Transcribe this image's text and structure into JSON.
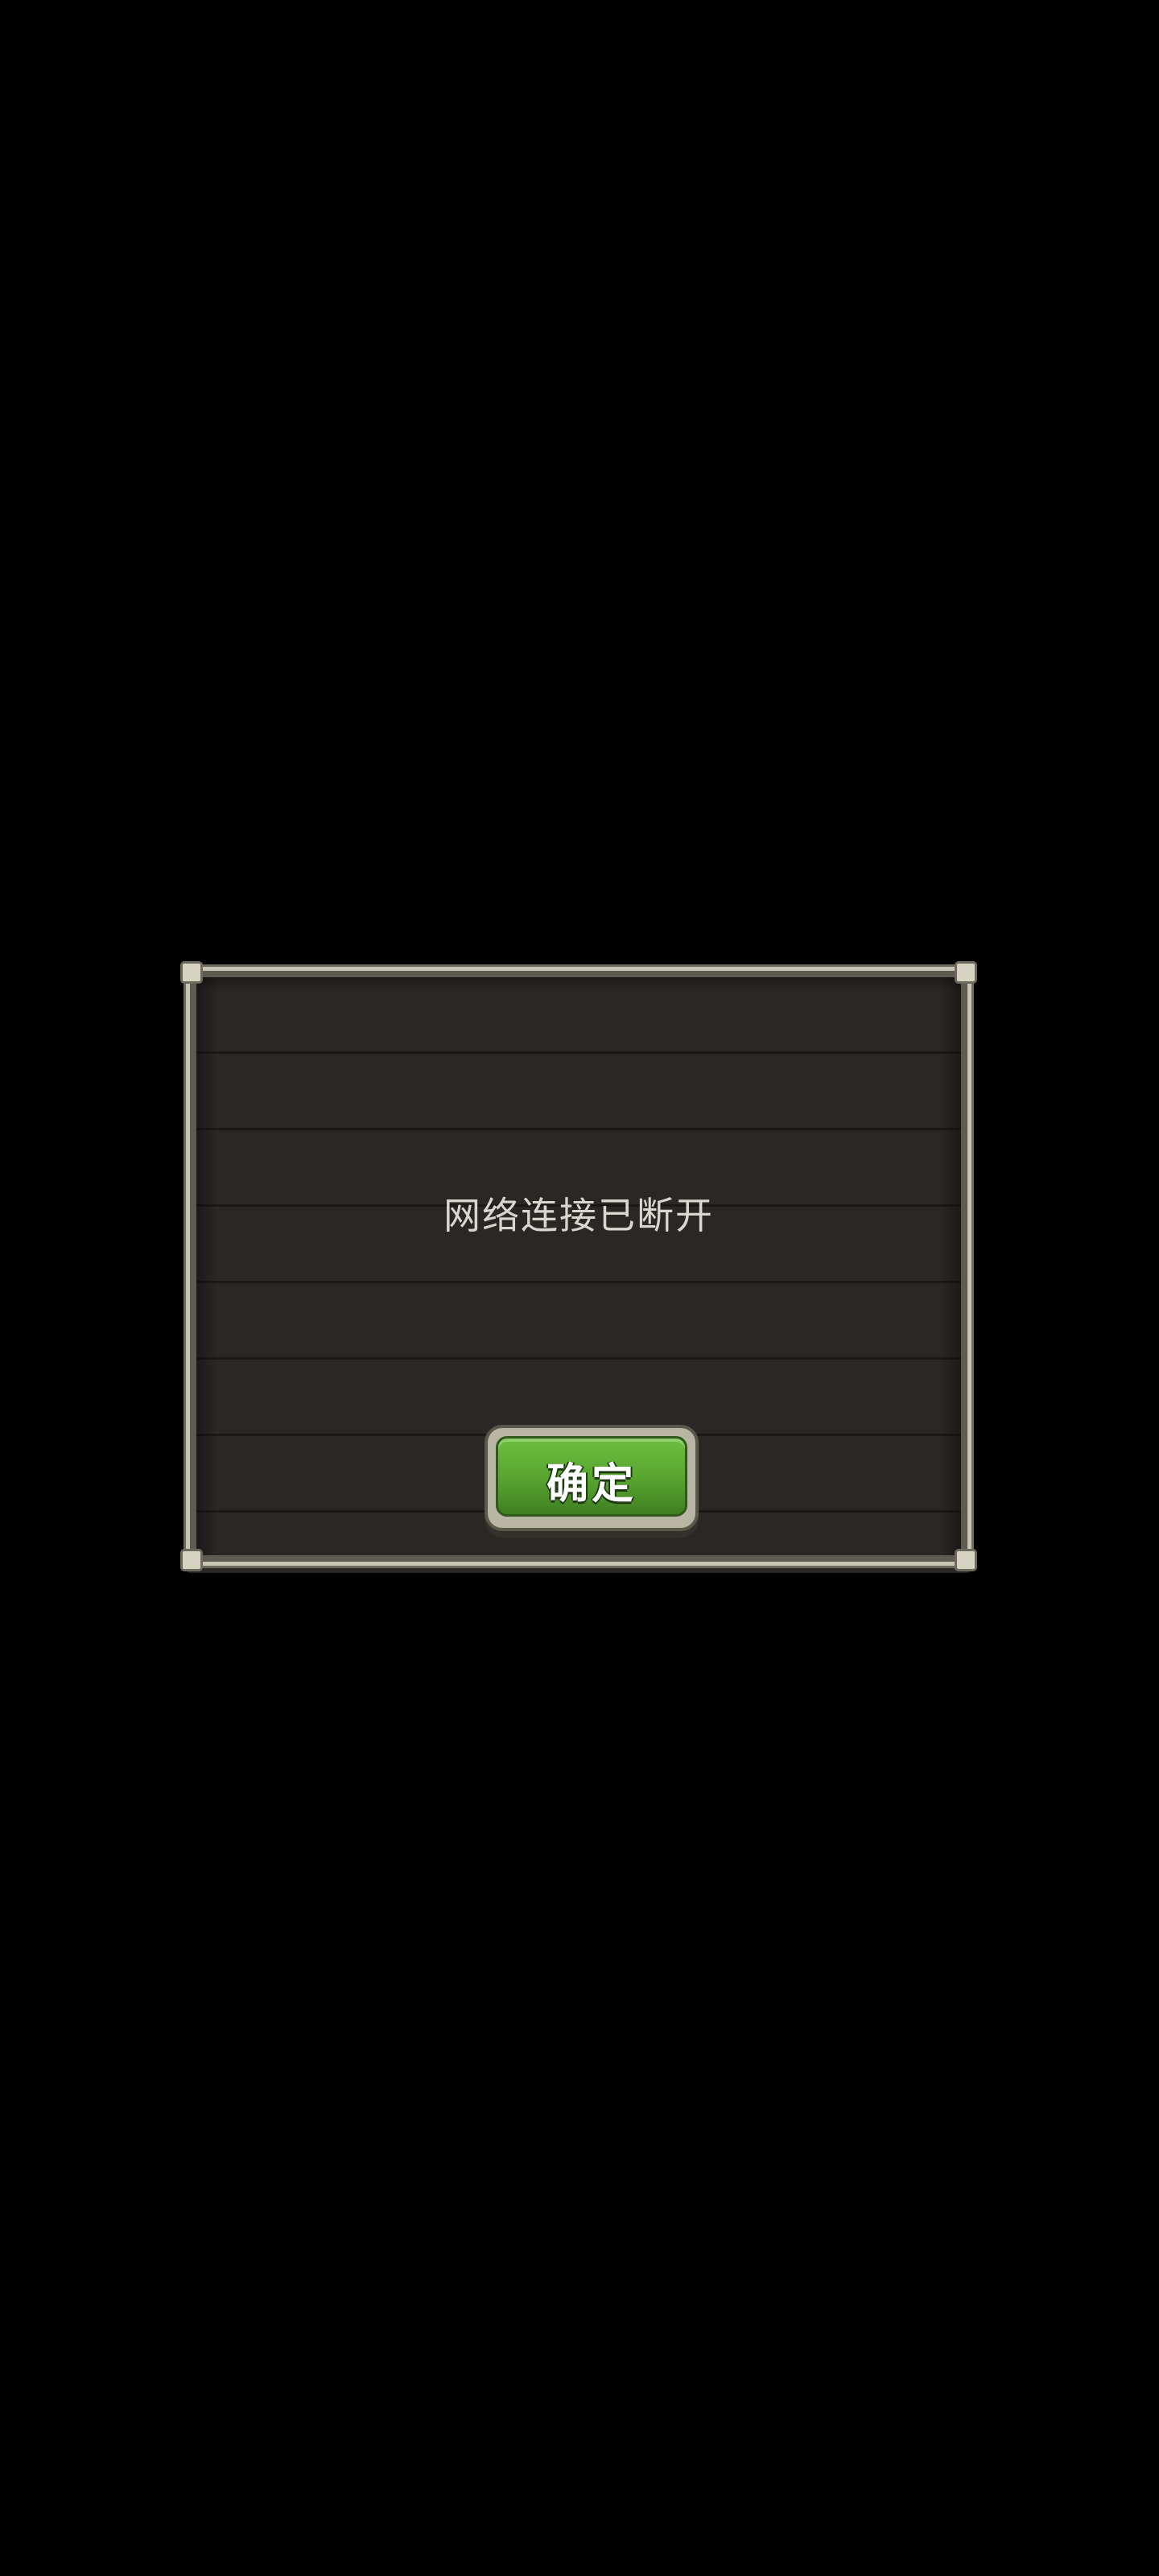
{
  "dialog": {
    "message": "网络连接已断开",
    "confirm_label": "确定"
  },
  "colors": {
    "background": "#000000",
    "board": "#2a2725",
    "frame": "#c9c5b4",
    "button_green": "#57a32f",
    "message_text": "#d9d6cf"
  }
}
